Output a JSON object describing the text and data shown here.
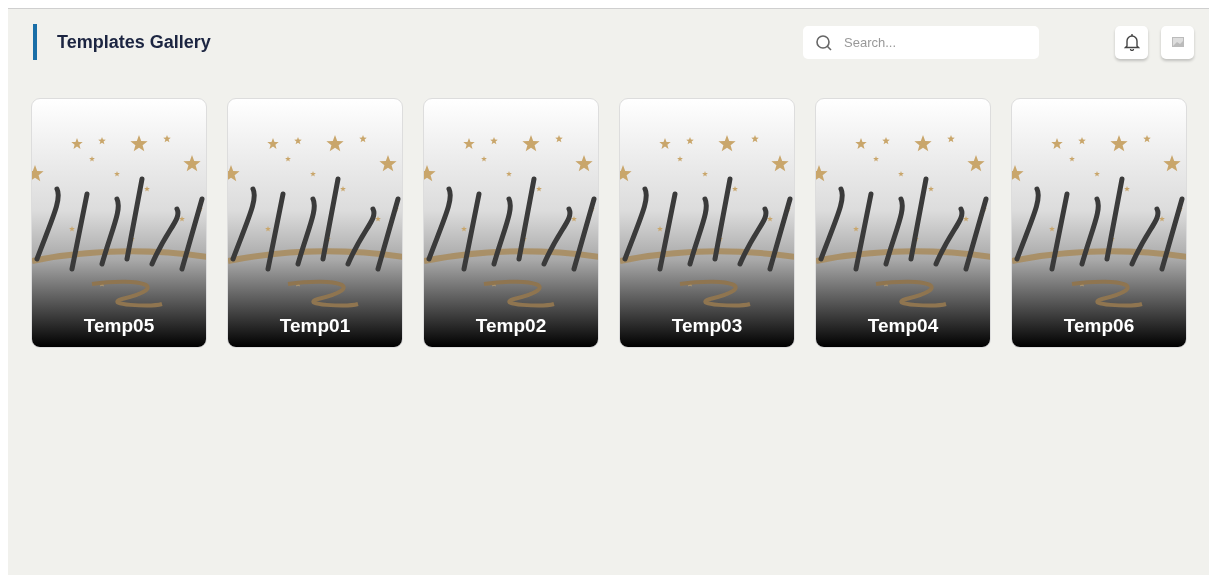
{
  "header": {
    "title": "Templates Gallery"
  },
  "search": {
    "placeholder": "Search..."
  },
  "templates": [
    {
      "name": "Temp05"
    },
    {
      "name": "Temp01"
    },
    {
      "name": "Temp02"
    },
    {
      "name": "Temp03"
    },
    {
      "name": "Temp04"
    },
    {
      "name": "Temp06"
    }
  ]
}
